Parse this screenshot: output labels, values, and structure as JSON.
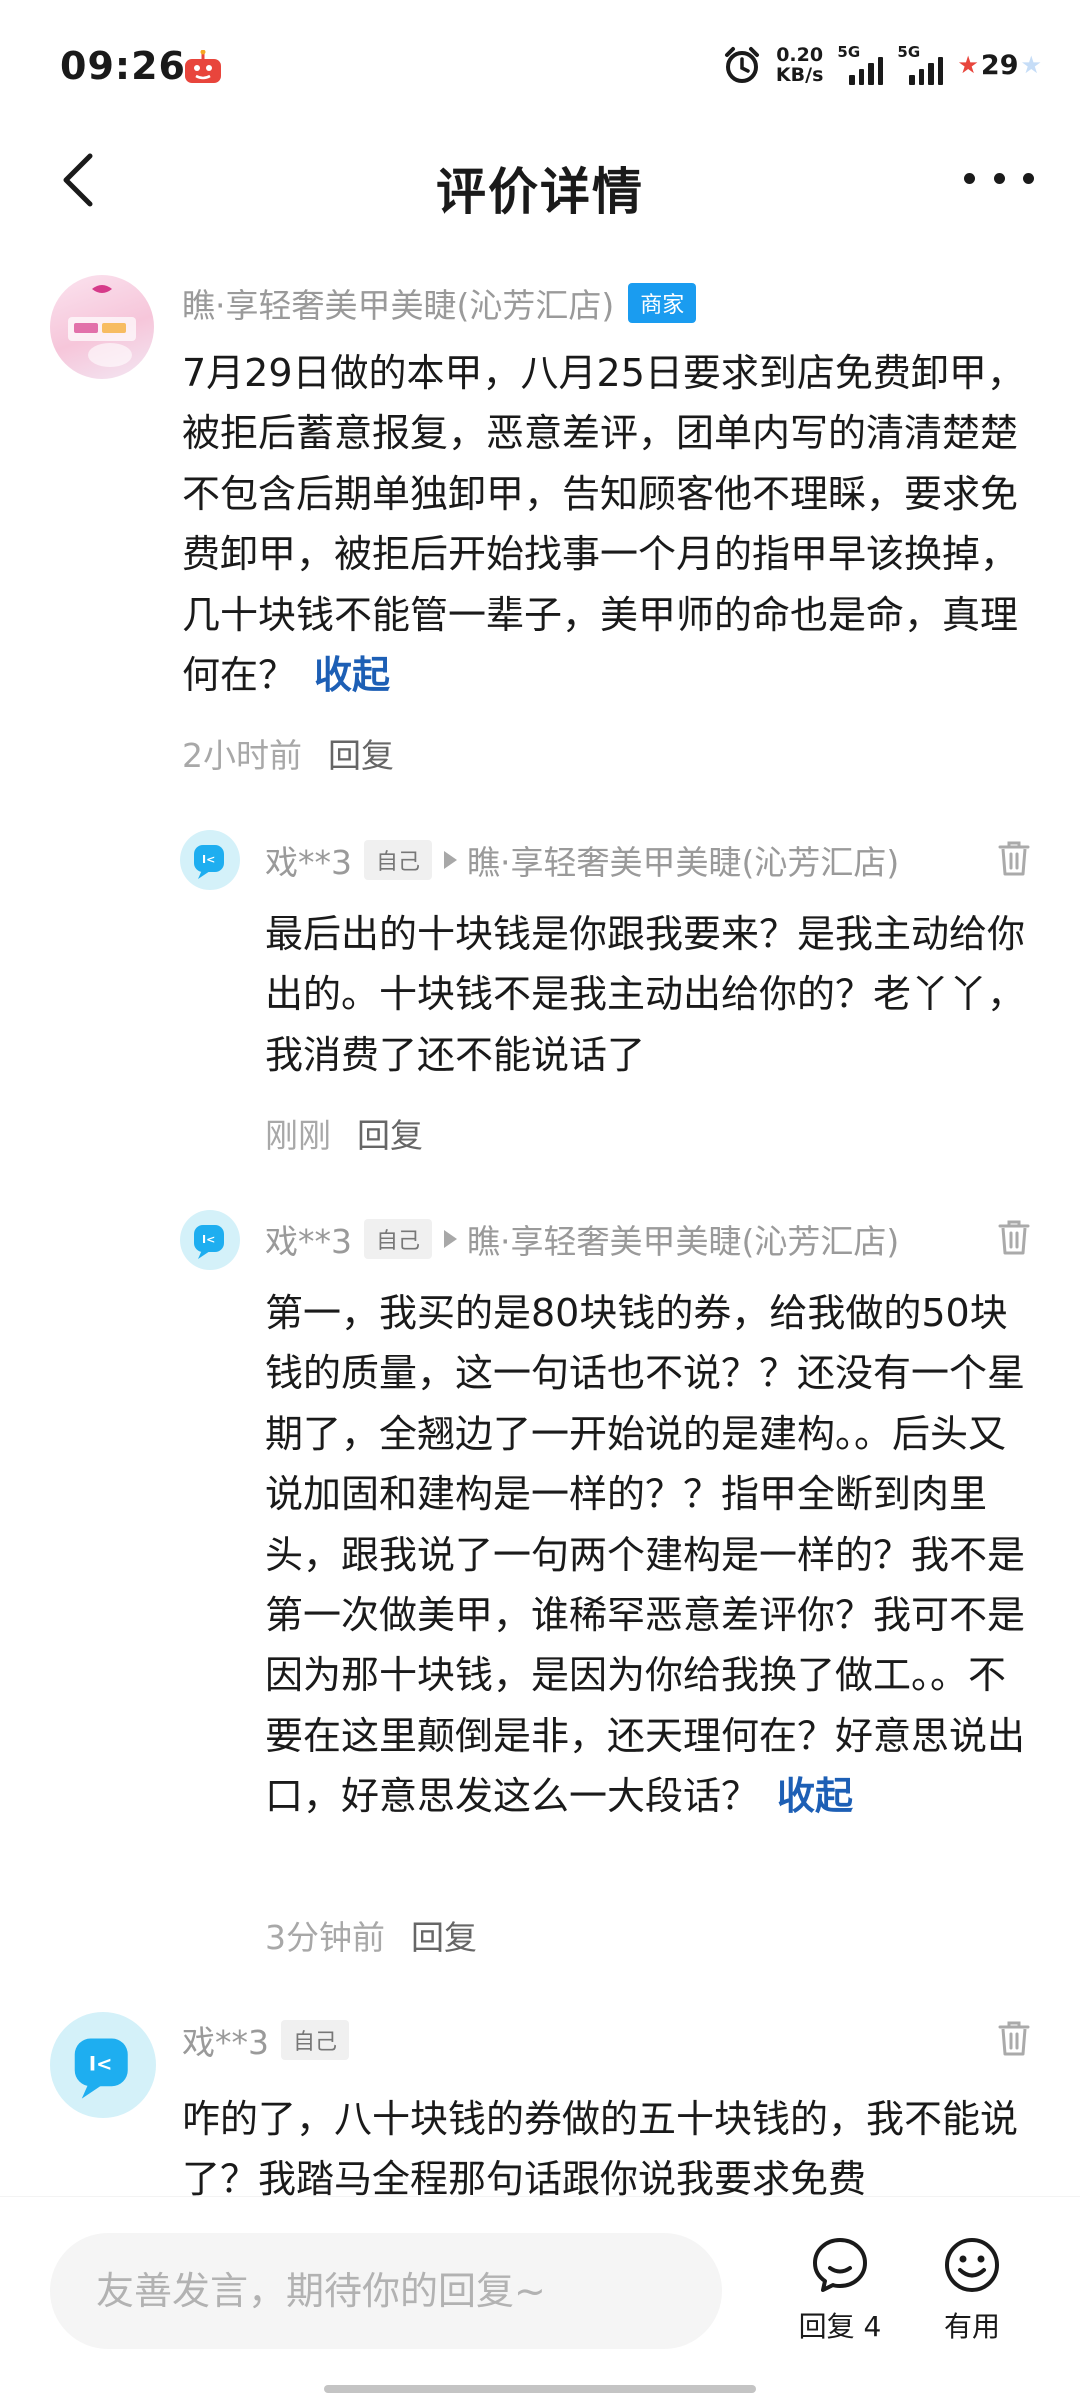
{
  "status_bar": {
    "time": "09:26",
    "net_speed_value": "0.20",
    "net_speed_unit": "KB/s",
    "signal_1": "5G",
    "signal_2": "5G",
    "battery": "29"
  },
  "header": {
    "title": "评价详情"
  },
  "shop_review": {
    "author": "瞧·享轻奢美甲美睫(沁芳汇店)",
    "tag": "商家",
    "text": "7月29日做的本甲，八月25日要求到店免费卸甲，被拒后蓄意报复，恶意差评，团单内写的清清楚楚不包含后期单独卸甲，告知顾客他不理睬，要求免费卸甲，被拒后开始找事一个月的指甲早该换掉，几十块钱不能管一辈子，美甲师的命也是命，真理何在？",
    "collapse": "收起",
    "time": "2小时前",
    "reply": "回复"
  },
  "replies": [
    {
      "author": "戏**3",
      "tag": "自己",
      "target": "瞧·享轻奢美甲美睫(沁芳汇店)",
      "text": "最后出的十块钱是你跟我要来？是我主动给你出的。十块钱不是我主动出给你的？老丫丫，我消费了还不能说话了",
      "time": "刚刚",
      "reply": "回复"
    },
    {
      "author": "戏**3",
      "tag": "自己",
      "target": "瞧·享轻奢美甲美睫(沁芳汇店)",
      "text": "第一，我买的是80块钱的券，给我做的50块钱的质量，这一句话也不说？？还没有一个星期了，全翘边了一开始说的是建构。。后头又说加固和建构是一样的？？指甲全断到肉里头，跟我说了一句两个建构是一样的？我不是第一次做美甲，谁稀罕恶意差评你？我可不是因为那十块钱，是因为你给我换了做工。。不要在这里颠倒是非，还天理何在？好意思说出口，好意思发这么一大段话？",
      "collapse": "收起",
      "time": "3分钟前",
      "reply": "回复"
    }
  ],
  "user_comment": {
    "author": "戏**3",
    "tag": "自己",
    "text": "咋的了，八十块钱的券做的五十块钱的，我不能说了？我踏马全程那句话跟你说我要求免费"
  },
  "bottom_bar": {
    "input_placeholder": "友善发言，期待你的回复~",
    "reply_label": "回复 4",
    "useful_label": "有用"
  },
  "colors": {
    "link_blue": "#1d5fb5",
    "merchant_tag": "#1a9cf0",
    "muted_text": "#9a9a9a"
  },
  "icons": [
    "back-arrow-icon",
    "more-dots-icon",
    "trash-icon",
    "reply-arrow-icon",
    "comment-bubble-icon",
    "smiley-icon",
    "alarm-icon"
  ]
}
